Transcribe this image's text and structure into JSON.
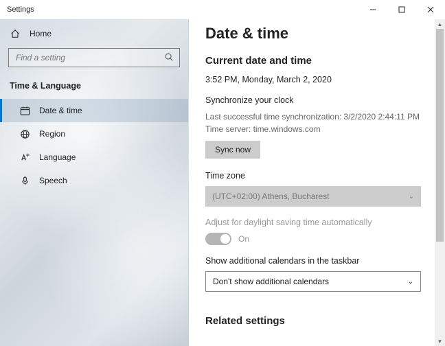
{
  "window": {
    "title": "Settings"
  },
  "sidebar": {
    "home": "Home",
    "search_placeholder": "Find a setting",
    "category": "Time & Language",
    "items": [
      {
        "label": "Date & time"
      },
      {
        "label": "Region"
      },
      {
        "label": "Language"
      },
      {
        "label": "Speech"
      }
    ]
  },
  "page": {
    "title": "Date & time",
    "current_heading": "Current date and time",
    "current_value": "3:52 PM, Monday, March 2, 2020",
    "sync_heading": "Synchronize your clock",
    "sync_last": "Last successful time synchronization: 3/2/2020 2:44:11 PM",
    "sync_server": "Time server: time.windows.com",
    "sync_button": "Sync now",
    "tz_heading": "Time zone",
    "tz_value": "(UTC+02:00) Athens, Bucharest",
    "dst_label": "Adjust for daylight saving time automatically",
    "dst_state": "On",
    "cal_heading": "Show additional calendars in the taskbar",
    "cal_value": "Don't show additional calendars",
    "related_heading": "Related settings"
  }
}
